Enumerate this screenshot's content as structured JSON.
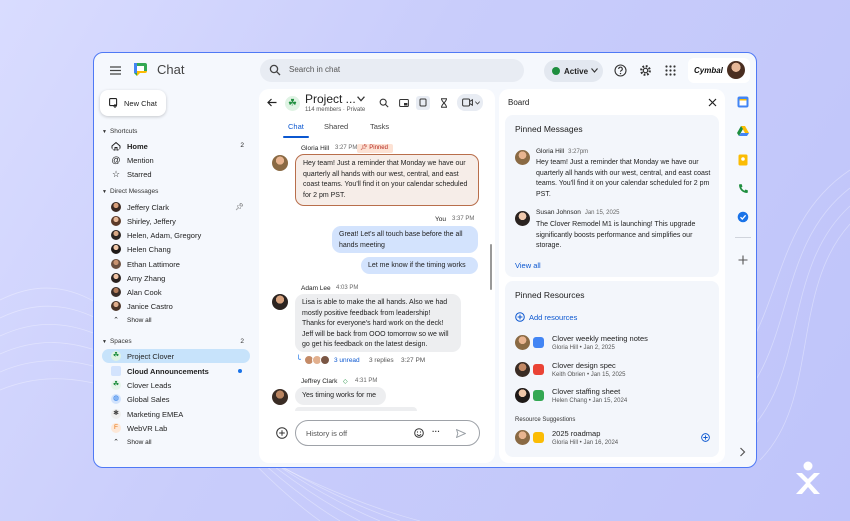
{
  "app": {
    "title": "Chat"
  },
  "search": {
    "placeholder": "Search in chat"
  },
  "status": {
    "label": "Active",
    "color": "#1e8e3e"
  },
  "org": {
    "name": "Cymbal"
  },
  "sidebar": {
    "new_chat": "New Chat",
    "shortcuts": {
      "heading": "Shortcuts",
      "items": [
        {
          "label": "Home",
          "count": "2",
          "icon": "home-icon"
        },
        {
          "label": "Mention",
          "icon": "at-icon"
        },
        {
          "label": "Starred",
          "icon": "star-icon"
        }
      ]
    },
    "direct_messages": {
      "heading": "Direct Messages",
      "items": [
        {
          "label": "Jeffery Clark",
          "pinned": true
        },
        {
          "label": "Shirley, Jeffery"
        },
        {
          "label": "Helen, Adam, Gregory"
        },
        {
          "label": "Helen Chang"
        },
        {
          "label": "Ethan Lattimore"
        },
        {
          "label": "Amy Zhang"
        },
        {
          "label": "Alan Cook"
        },
        {
          "label": "Janice Castro"
        }
      ],
      "show_all": "Show all"
    },
    "spaces": {
      "heading": "Spaces",
      "count": "2",
      "items": [
        {
          "label": "Project Clover",
          "selected": true
        },
        {
          "label": "Cloud Announcements",
          "bold": true,
          "unread": true
        },
        {
          "label": "Clover Leads"
        },
        {
          "label": "Global Sales"
        },
        {
          "label": "Marketing EMEA"
        },
        {
          "label": "WebVR Lab"
        }
      ],
      "show_all": "Show all"
    }
  },
  "chat": {
    "title": "Project ...",
    "subtitle": "114 members · Private",
    "tabs": [
      {
        "label": "Chat",
        "active": true
      },
      {
        "label": "Shared"
      },
      {
        "label": "Tasks"
      }
    ],
    "messages": [
      {
        "sender": "Gloria Hill",
        "time": "3:27 PM",
        "tag": "Pinned",
        "text": "Hey team! Just a reminder that Monday we have our quarterly all hands with our west, central, and east coast teams. You'll find it on your calendar scheduled for 2 pm PST."
      },
      {
        "sender": "You",
        "time": "3:37 PM",
        "texts": [
          "Great! Let's all touch base before the all hands meeting",
          "Let me know if the timing works"
        ]
      },
      {
        "sender": "Adam Lee",
        "time": "4:03 PM",
        "text": "Lisa is able to make the all hands. Also we had mostly positive feedback from leadership! Thanks for everyone's hard work on the deck! Jeff will  be back from OOO tomorrow so we will go get his feedback on the latest design.",
        "thread": {
          "unread": "3 unread",
          "replies": "3 replies",
          "time": "3:27 PM"
        }
      },
      {
        "sender": "Jeffrey Clark",
        "time": "4:31 PM",
        "text": "Yes timing works for me"
      }
    ],
    "composer": {
      "placeholder": "History is off"
    }
  },
  "board": {
    "title": "Board",
    "pinned_messages": {
      "heading": "Pinned Messages",
      "items": [
        {
          "sender": "Gloria Hill",
          "time": "3:27pm",
          "text": "Hey team! Just a reminder that Monday we have our quarterly all hands with our west, central, and east coast teams. You'll find it on your calendar scheduled for 2 pm PST."
        },
        {
          "sender": "Susan Johnson",
          "time": "Jan 15, 2025",
          "text": "The Clover Remodel M1 is launching! This upgrade significantly boosts performance and simplifies our storage."
        }
      ],
      "view_all": "View all"
    },
    "pinned_resources": {
      "heading": "Pinned Resources",
      "add": "Add resources",
      "items": [
        {
          "name": "Clover weekly meeting notes",
          "meta": "Gloria Hill • Jan 2, 2025",
          "icon": "docs-icon",
          "color": "#4285f4"
        },
        {
          "name": "Clover design spec",
          "meta": "Keith Obrien • Jan 15, 2025",
          "icon": "slides-icon",
          "color": "#ea4335"
        },
        {
          "name": "Clover staffing sheet",
          "meta": "Helen Chang • Jan 15, 2024",
          "icon": "sheets-icon",
          "color": "#34a853"
        }
      ],
      "suggestions_heading": "Resource Suggestions",
      "suggestions": [
        {
          "name": "2025 roadmap",
          "meta": "Gloria Hill • Jan 16, 2024",
          "icon": "slides-icon",
          "color": "#fbbc04"
        }
      ]
    }
  },
  "colors": {
    "accent": "#0b57d0",
    "window_border": "#4f79f5",
    "selected": "#c7e3fb"
  }
}
